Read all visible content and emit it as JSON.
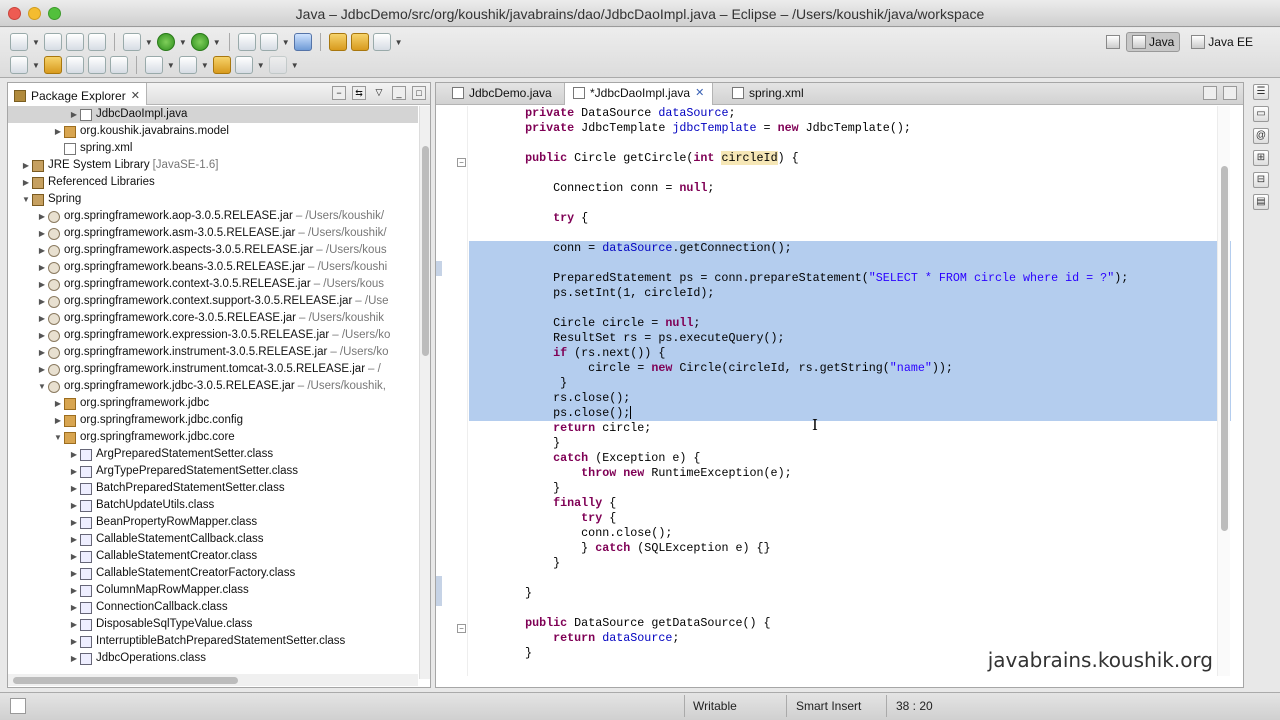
{
  "window": {
    "title": "Java – JdbcDemo/src/org/koushik/javabrains/dao/JdbcDaoImpl.java – Eclipse – /Users/koushik/java/workspace"
  },
  "perspectives": {
    "java": "Java",
    "javaee": "Java EE"
  },
  "package_explorer": {
    "title": "Package Explorer",
    "items": [
      {
        "label": "JdbcDaoImpl.java",
        "icon": "java-file-icon",
        "suffix": ""
      },
      {
        "label": "org.koushik.javabrains.model",
        "icon": "package-icon",
        "suffix": ""
      },
      {
        "label": "spring.xml",
        "icon": "xml-file-icon",
        "suffix": ""
      },
      {
        "label": "JRE System Library",
        "icon": "library-icon",
        "suffix": "[JavaSE-1.6]"
      },
      {
        "label": "Referenced Libraries",
        "icon": "library-icon",
        "suffix": ""
      },
      {
        "label": "Spring",
        "icon": "library-icon",
        "suffix": ""
      },
      {
        "label": "org.springframework.aop-3.0.5.RELEASE.jar",
        "icon": "jar-icon",
        "suffix": "– /Users/koushik/"
      },
      {
        "label": "org.springframework.asm-3.0.5.RELEASE.jar",
        "icon": "jar-icon",
        "suffix": "– /Users/koushik/"
      },
      {
        "label": "org.springframework.aspects-3.0.5.RELEASE.jar",
        "icon": "jar-icon",
        "suffix": "– /Users/kous"
      },
      {
        "label": "org.springframework.beans-3.0.5.RELEASE.jar",
        "icon": "jar-icon",
        "suffix": "– /Users/koushi"
      },
      {
        "label": "org.springframework.context-3.0.5.RELEASE.jar",
        "icon": "jar-icon",
        "suffix": "– /Users/kous"
      },
      {
        "label": "org.springframework.context.support-3.0.5.RELEASE.jar",
        "icon": "jar-icon",
        "suffix": "– /Use"
      },
      {
        "label": "org.springframework.core-3.0.5.RELEASE.jar",
        "icon": "jar-icon",
        "suffix": "– /Users/koushik"
      },
      {
        "label": "org.springframework.expression-3.0.5.RELEASE.jar",
        "icon": "jar-icon",
        "suffix": "– /Users/ko"
      },
      {
        "label": "org.springframework.instrument-3.0.5.RELEASE.jar",
        "icon": "jar-icon",
        "suffix": "– /Users/ko"
      },
      {
        "label": "org.springframework.instrument.tomcat-3.0.5.RELEASE.jar",
        "icon": "jar-icon",
        "suffix": "– /"
      },
      {
        "label": "org.springframework.jdbc-3.0.5.RELEASE.jar",
        "icon": "jar-icon",
        "suffix": "– /Users/koushik,"
      },
      {
        "label": "org.springframework.jdbc",
        "icon": "package-icon",
        "suffix": ""
      },
      {
        "label": "org.springframework.jdbc.config",
        "icon": "package-icon",
        "suffix": ""
      },
      {
        "label": "org.springframework.jdbc.core",
        "icon": "package-icon",
        "suffix": ""
      },
      {
        "label": "ArgPreparedStatementSetter.class",
        "icon": "class-file-icon",
        "suffix": ""
      },
      {
        "label": "ArgTypePreparedStatementSetter.class",
        "icon": "class-file-icon",
        "suffix": ""
      },
      {
        "label": "BatchPreparedStatementSetter.class",
        "icon": "class-file-icon",
        "suffix": ""
      },
      {
        "label": "BatchUpdateUtils.class",
        "icon": "class-file-icon",
        "suffix": ""
      },
      {
        "label": "BeanPropertyRowMapper.class",
        "icon": "class-file-icon",
        "suffix": ""
      },
      {
        "label": "CallableStatementCallback.class",
        "icon": "class-file-icon",
        "suffix": ""
      },
      {
        "label": "CallableStatementCreator.class",
        "icon": "class-file-icon",
        "suffix": ""
      },
      {
        "label": "CallableStatementCreatorFactory.class",
        "icon": "class-file-icon",
        "suffix": ""
      },
      {
        "label": "ColumnMapRowMapper.class",
        "icon": "class-file-icon",
        "suffix": ""
      },
      {
        "label": "ConnectionCallback.class",
        "icon": "class-file-icon",
        "suffix": ""
      },
      {
        "label": "DisposableSqlTypeValue.class",
        "icon": "class-file-icon",
        "suffix": ""
      },
      {
        "label": "InterruptibleBatchPreparedStatementSetter.class",
        "icon": "class-file-icon",
        "suffix": ""
      },
      {
        "label": "JdbcOperations.class",
        "icon": "class-file-icon",
        "suffix": ""
      }
    ]
  },
  "editor": {
    "tabs": [
      {
        "label": "JdbcDemo.java"
      },
      {
        "label": "*JdbcDaoImpl.java"
      },
      {
        "label": "spring.xml"
      }
    ],
    "lines": [
      "    private DataSource dataSource;",
      "    private JdbcTemplate jdbcTemplate = new JdbcTemplate();",
      "",
      "    public Circle getCircle(int circleId) {",
      "",
      "        Connection conn = null;",
      "",
      "        try {",
      "",
      "        conn = dataSource.getConnection();",
      "",
      "        PreparedStatement ps = conn.prepareStatement(\"SELECT * FROM circle where id = ?\");",
      "        ps.setInt(1, circleId);",
      "",
      "        Circle circle = null;",
      "        ResultSet rs = ps.executeQuery();",
      "        if (rs.next()) {",
      "             circle = new Circle(circleId, rs.getString(\"name\"));",
      "         }",
      "        rs.close();",
      "        ps.close();",
      "        return circle;",
      "        }",
      "        catch (Exception e) {",
      "            throw new RuntimeException(e);",
      "        }",
      "        finally {",
      "            try {",
      "            conn.close();",
      "            } catch (SQLException e) {}",
      "        }",
      "",
      "    }",
      "",
      "    public DataSource getDataSource() {",
      "        return dataSource;",
      "    }"
    ]
  },
  "watermark": "javabrains.koushik.org",
  "status": {
    "mode": "Writable",
    "insert": "Smart Insert",
    "position": "38 : 20"
  }
}
